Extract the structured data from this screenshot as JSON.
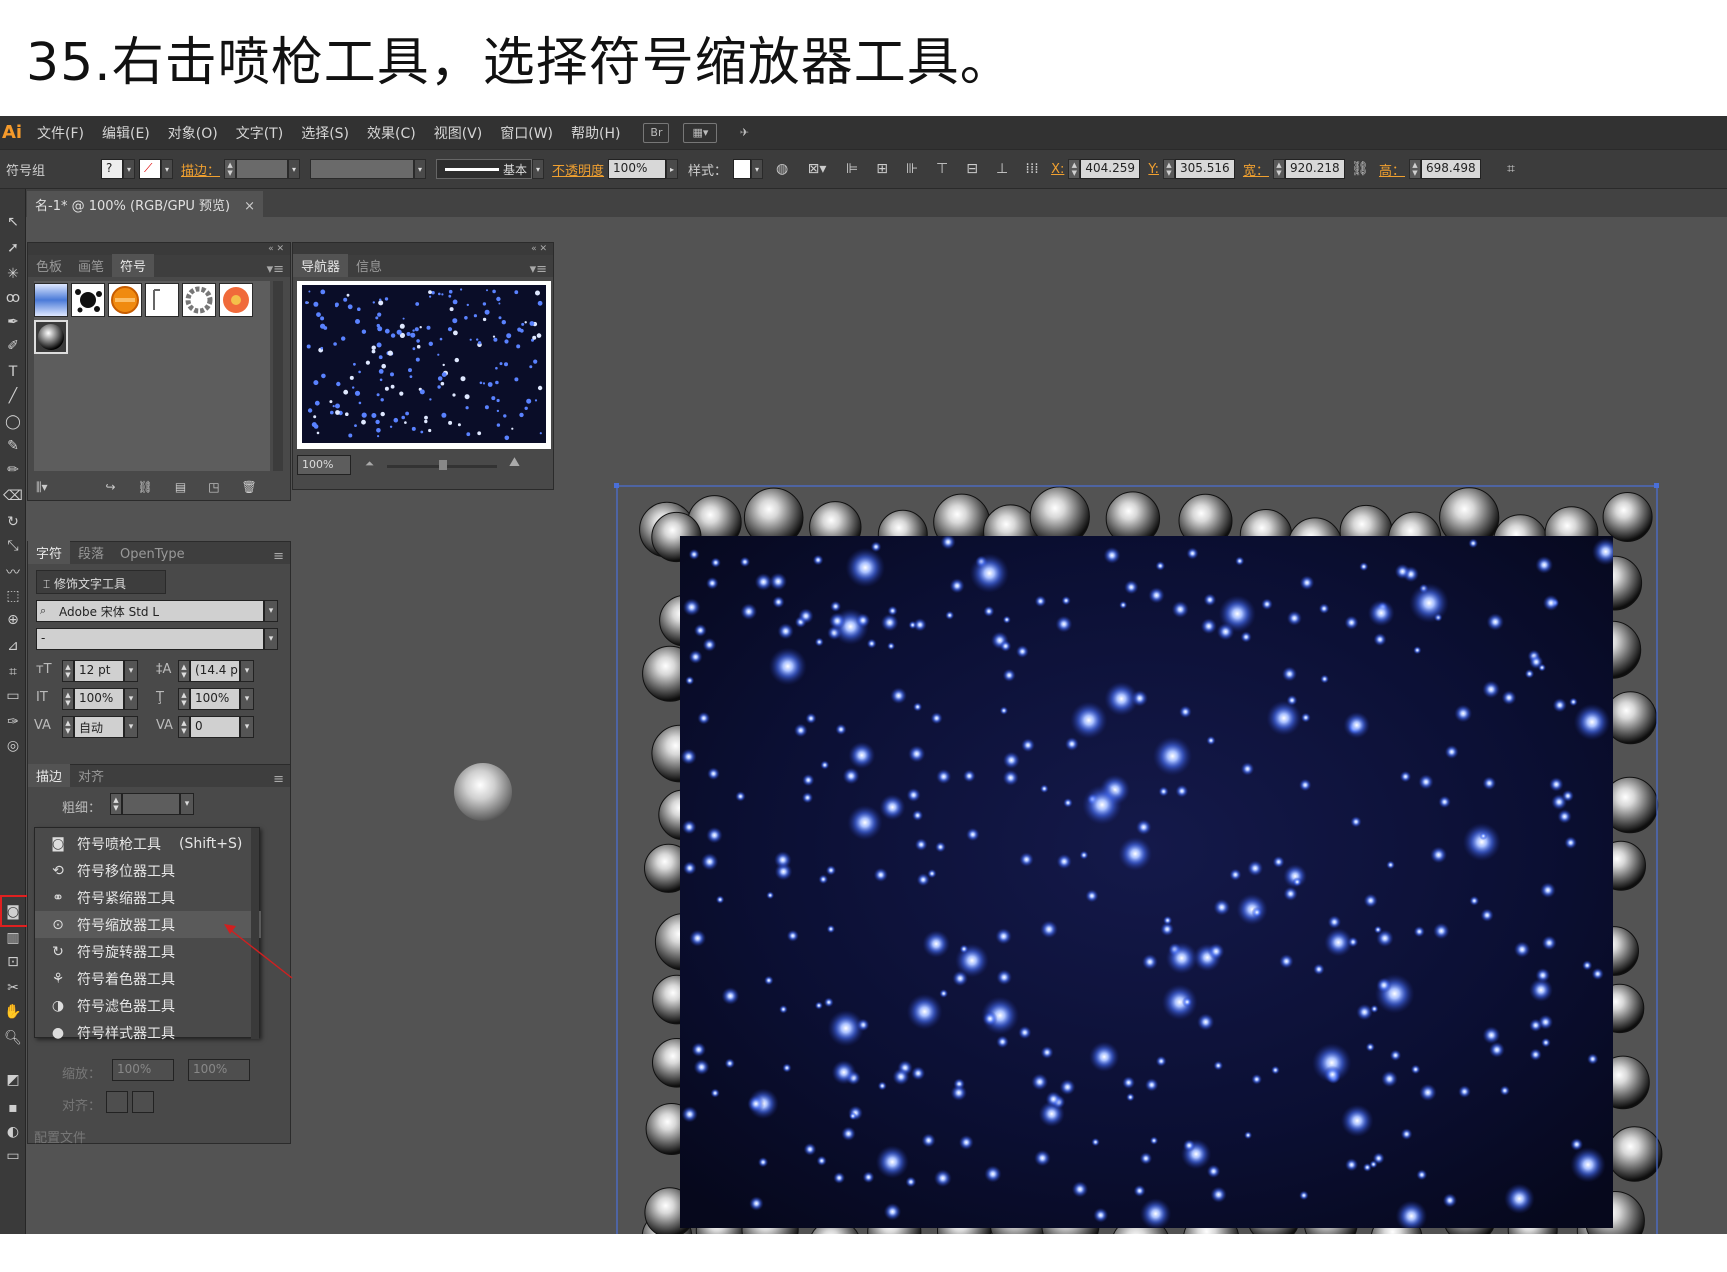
{
  "caption": "35.右击喷枪工具，选择符号缩放器工具。",
  "app_logo": "Ai",
  "menu": [
    "文件(F)",
    "编辑(E)",
    "对象(O)",
    "文字(T)",
    "选择(S)",
    "效果(C)",
    "视图(V)",
    "窗口(W)",
    "帮助(H)"
  ],
  "menubar_br": "Br",
  "control": {
    "group_label": "符号组",
    "stroke_label": "描边：",
    "stroke_profile": "基本",
    "opacity_label": "不透明度",
    "opacity_value": "100%",
    "style_label": "样式：",
    "x_label": "X:",
    "x_value": "404.259",
    "y_label": "Y:",
    "y_value": "305.516",
    "w_label": "宽：",
    "w_value": "920.218",
    "h_label": "高：",
    "h_value": "698.498"
  },
  "doc_tab": {
    "title": "名-1* @ 100% (RGB/GPU 预览)",
    "close": "×"
  },
  "swatch_panel": {
    "tabs": [
      "色板",
      "画笔",
      "符号"
    ],
    "active_tab": "符号"
  },
  "navigator_panel": {
    "tabs": [
      "导航器",
      "信息"
    ],
    "active_tab": "导航器",
    "zoom": "100%"
  },
  "character_panel": {
    "tabs": [
      "字符",
      "段落",
      "OpenType"
    ],
    "active_tab": "字符",
    "touch_type_button": "修饰文字工具",
    "font_family": "Adobe 宋体 Std L",
    "font_style": "-",
    "font_size": "12 pt",
    "leading": "(14.4 p",
    "vertical_scale": "100%",
    "horizontal_scale": "100%",
    "kerning": "自动",
    "tracking": "0"
  },
  "stroke_panel": {
    "tabs": [
      "描边",
      "对齐"
    ],
    "active_tab": "描边",
    "weight_label": "粗细：",
    "scale_label": "缩放：",
    "scale_value_1": "100%",
    "scale_value_2": "100%",
    "align_label": "对齐：",
    "profile_label": "配置文件"
  },
  "flyout": [
    {
      "label": "符号喷枪工具",
      "shortcut": "(Shift+S)",
      "icon": "sprayer-icon"
    },
    {
      "label": "符号移位器工具",
      "shortcut": "",
      "icon": "shifter-icon"
    },
    {
      "label": "符号紧缩器工具",
      "shortcut": "",
      "icon": "scruncher-icon"
    },
    {
      "label": "符号缩放器工具",
      "shortcut": "",
      "icon": "sizer-icon"
    },
    {
      "label": "符号旋转器工具",
      "shortcut": "",
      "icon": "spinner-icon"
    },
    {
      "label": "符号着色器工具",
      "shortcut": "",
      "icon": "stainer-icon"
    },
    {
      "label": "符号滤色器工具",
      "shortcut": "",
      "icon": "screener-icon"
    },
    {
      "label": "符号样式器工具",
      "shortcut": "",
      "icon": "styler-icon"
    }
  ],
  "flyout_highlighted": "符号缩放器工具",
  "colors": {
    "menubar_bg": "#323232",
    "panel_bg": "#494949",
    "canvas_bg": "#535353",
    "accent_orange": "#f0a030",
    "highlight_red": "#e02020",
    "artwork_bg": "#0a0d28",
    "glow_blue": "#4b74ff",
    "selection_blue": "#4a6fd8"
  }
}
